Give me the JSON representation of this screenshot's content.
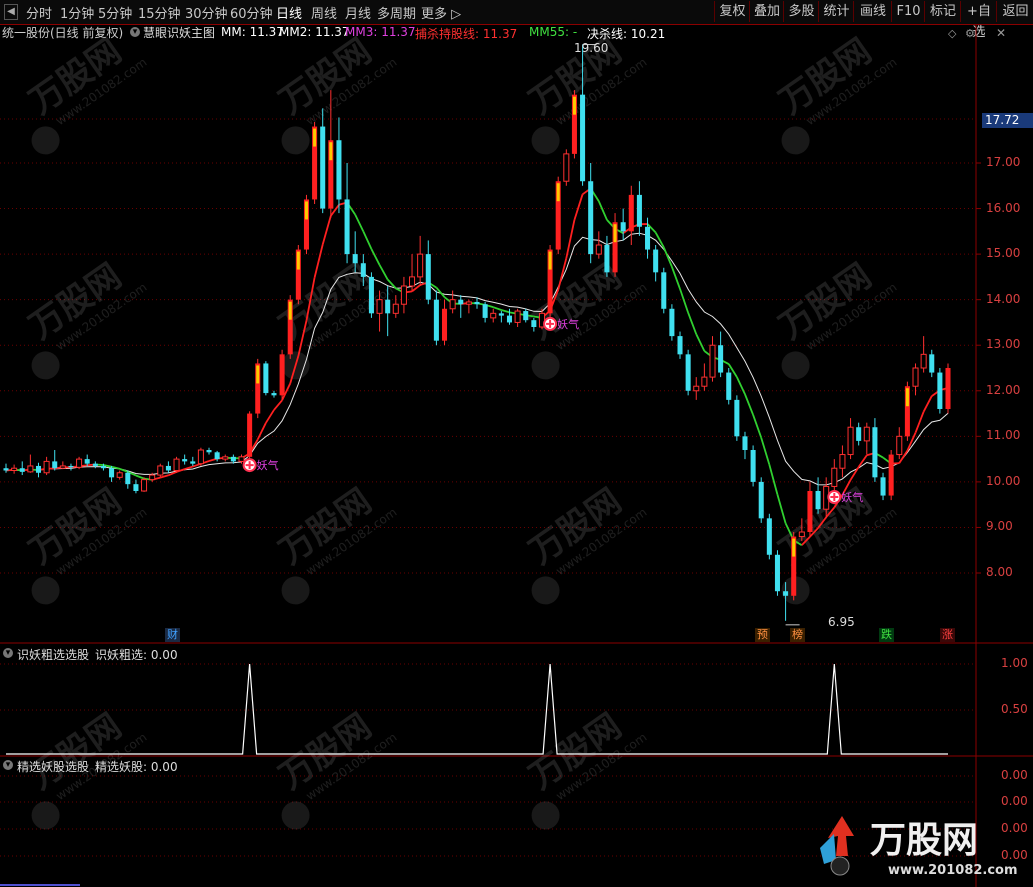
{
  "toolbar": {
    "tabs": [
      "分时",
      "1分钟",
      "5分钟",
      "15分钟",
      "30分钟",
      "60分钟",
      "日线",
      "周线",
      "月线",
      "多周期",
      "更多"
    ],
    "active_tab": "日线",
    "buttons": [
      "复权",
      "叠加",
      "多股",
      "统计",
      "画线",
      "F10",
      "标记",
      "+自选",
      "返回"
    ]
  },
  "main_panel": {
    "stock": "统一股份(日线 前复权)",
    "indicator_name": "慧眼识妖主图",
    "lines": [
      {
        "label": "MM: 11.37",
        "color": "#ffffff"
      },
      {
        "label": "MM2: 11.37",
        "color": "#ffffff"
      },
      {
        "label": "MM3: 11.37",
        "color": "#e040e0"
      },
      {
        "label": "捕杀持股线: 11.37",
        "color": "#ff3030"
      },
      {
        "label": "MM55: -",
        "color": "#40e040"
      },
      {
        "label": "决杀线: 10.21",
        "color": "#ffffff"
      }
    ],
    "price_tag": "17.72",
    "high_label": "19.60",
    "low_label": "6.95",
    "signal_text": "妖气",
    "y_labels": [
      "17.00",
      "16.00",
      "15.00",
      "14.00",
      "13.00",
      "12.00",
      "11.00",
      "10.00",
      "9.00",
      "8.00"
    ],
    "events": [
      {
        "text": "财",
        "color": "#40a0ff"
      },
      {
        "text": "预",
        "color": "#ff9040"
      },
      {
        "text": "榜",
        "color": "#ff9040"
      },
      {
        "text": "跌",
        "color": "#40e040"
      },
      {
        "text": "涨",
        "color": "#ff4040"
      }
    ]
  },
  "panel2": {
    "title": "识妖粗选选股",
    "value_label": "识妖粗选: 0.00",
    "y_labels": [
      "1.00",
      "0.50"
    ]
  },
  "panel3": {
    "title": "精选妖股选股",
    "value_label": "精选妖股: 0.00",
    "y_labels": [
      "0.00",
      "0.00",
      "0.00",
      "0.00"
    ]
  },
  "watermark": {
    "brand": "万股网",
    "url": "www.201082.com"
  },
  "chart_data": {
    "type": "candlestick",
    "ylim": [
      6.8,
      19.8
    ],
    "signals_day_index": [
      30,
      67,
      102
    ],
    "candles": [
      [
        10.3,
        10.25,
        10.4,
        10.2
      ],
      [
        10.25,
        10.3,
        10.38,
        10.18
      ],
      [
        10.3,
        10.22,
        10.45,
        10.15
      ],
      [
        10.22,
        10.35,
        10.6,
        10.2
      ],
      [
        10.35,
        10.2,
        10.42,
        10.1
      ],
      [
        10.2,
        10.45,
        10.55,
        10.15
      ],
      [
        10.45,
        10.3,
        10.7,
        10.25
      ],
      [
        10.3,
        10.35,
        10.45,
        10.28
      ],
      [
        10.35,
        10.32,
        10.4,
        10.25
      ],
      [
        10.32,
        10.5,
        10.55,
        10.28
      ],
      [
        10.5,
        10.4,
        10.6,
        10.35
      ],
      [
        10.4,
        10.35,
        10.45,
        10.3
      ],
      [
        10.35,
        10.3,
        10.4,
        10.25
      ],
      [
        10.3,
        10.1,
        10.35,
        10.0
      ],
      [
        10.1,
        10.2,
        10.25,
        10.05
      ],
      [
        10.2,
        9.95,
        10.25,
        9.85
      ],
      [
        9.95,
        9.8,
        10.05,
        9.75
      ],
      [
        9.8,
        10.05,
        10.1,
        9.78
      ],
      [
        10.05,
        10.15,
        10.2,
        10.0
      ],
      [
        10.15,
        10.35,
        10.4,
        10.1
      ],
      [
        10.35,
        10.25,
        10.45,
        10.2
      ],
      [
        10.25,
        10.5,
        10.55,
        10.2
      ],
      [
        10.5,
        10.45,
        10.6,
        10.38
      ],
      [
        10.45,
        10.4,
        10.55,
        10.35
      ],
      [
        10.4,
        10.7,
        10.75,
        10.35
      ],
      [
        10.7,
        10.65,
        10.75,
        10.6
      ],
      [
        10.65,
        10.5,
        10.68,
        10.45
      ],
      [
        10.5,
        10.55,
        10.6,
        10.45
      ],
      [
        10.55,
        10.45,
        10.6,
        10.4
      ],
      [
        10.45,
        10.55,
        10.6,
        10.4
      ],
      [
        10.55,
        11.5,
        11.55,
        10.5
      ],
      [
        11.5,
        12.6,
        12.7,
        11.4
      ],
      [
        12.6,
        11.95,
        12.65,
        11.9
      ],
      [
        11.95,
        11.9,
        12.0,
        11.85
      ],
      [
        11.9,
        12.8,
        12.9,
        11.8
      ],
      [
        12.8,
        14.0,
        14.1,
        12.7
      ],
      [
        14.0,
        15.1,
        15.2,
        13.9
      ],
      [
        15.1,
        16.2,
        16.3,
        15.0
      ],
      [
        16.2,
        17.8,
        17.9,
        16.1
      ],
      [
        17.8,
        16.0,
        18.2,
        15.9
      ],
      [
        16.0,
        17.5,
        18.6,
        15.8
      ],
      [
        17.5,
        16.2,
        18.0,
        15.9
      ],
      [
        16.2,
        15.0,
        17.0,
        14.8
      ],
      [
        15.0,
        14.8,
        15.5,
        14.6
      ],
      [
        14.8,
        14.5,
        15.0,
        14.3
      ],
      [
        14.5,
        13.7,
        14.6,
        13.6
      ],
      [
        13.7,
        14.0,
        14.2,
        13.3
      ],
      [
        14.0,
        13.7,
        14.3,
        13.2
      ],
      [
        13.7,
        13.9,
        14.1,
        13.6
      ],
      [
        13.9,
        14.3,
        14.5,
        13.7
      ],
      [
        14.3,
        14.5,
        15.0,
        14.2
      ],
      [
        14.5,
        15.0,
        15.4,
        14.3
      ],
      [
        15.0,
        14.0,
        15.3,
        13.9
      ],
      [
        14.0,
        13.1,
        14.2,
        13.0
      ],
      [
        13.1,
        13.8,
        14.0,
        13.0
      ],
      [
        13.8,
        14.0,
        14.2,
        13.7
      ],
      [
        14.0,
        13.9,
        14.1,
        13.6
      ],
      [
        13.9,
        13.95,
        14.0,
        13.7
      ],
      [
        13.95,
        13.9,
        14.05,
        13.8
      ],
      [
        13.9,
        13.6,
        13.95,
        13.5
      ],
      [
        13.6,
        13.7,
        13.8,
        13.5
      ],
      [
        13.7,
        13.65,
        13.75,
        13.5
      ],
      [
        13.65,
        13.5,
        13.8,
        13.45
      ],
      [
        13.5,
        13.75,
        13.8,
        13.4
      ],
      [
        13.75,
        13.55,
        13.8,
        13.5
      ],
      [
        13.55,
        13.4,
        13.6,
        13.3
      ],
      [
        13.4,
        13.7,
        13.8,
        13.35
      ],
      [
        13.7,
        15.1,
        15.2,
        13.6
      ],
      [
        15.1,
        16.6,
        16.7,
        15.0
      ],
      [
        16.6,
        17.2,
        17.3,
        16.5
      ],
      [
        17.2,
        18.5,
        18.6,
        17.1
      ],
      [
        18.5,
        16.6,
        19.6,
        16.5
      ],
      [
        16.6,
        15.0,
        17.0,
        14.8
      ],
      [
        15.0,
        15.2,
        15.5,
        14.9
      ],
      [
        15.2,
        14.6,
        15.4,
        14.5
      ],
      [
        14.6,
        15.7,
        15.9,
        14.5
      ],
      [
        15.7,
        15.5,
        16.0,
        15.3
      ],
      [
        15.5,
        16.3,
        16.5,
        15.2
      ],
      [
        16.3,
        15.6,
        16.6,
        15.4
      ],
      [
        15.6,
        15.1,
        15.8,
        14.9
      ],
      [
        15.1,
        14.6,
        15.2,
        14.4
      ],
      [
        14.6,
        13.8,
        14.7,
        13.7
      ],
      [
        13.8,
        13.2,
        13.9,
        13.1
      ],
      [
        13.2,
        12.8,
        13.3,
        12.7
      ],
      [
        12.8,
        12.0,
        12.9,
        11.9
      ],
      [
        12.0,
        12.1,
        12.3,
        11.8
      ],
      [
        12.1,
        12.3,
        12.6,
        12.0
      ],
      [
        12.3,
        13.0,
        13.2,
        12.2
      ],
      [
        13.0,
        12.4,
        13.3,
        12.3
      ],
      [
        12.4,
        11.8,
        12.5,
        11.7
      ],
      [
        11.8,
        11.0,
        11.9,
        10.9
      ],
      [
        11.0,
        10.7,
        11.1,
        10.5
      ],
      [
        10.7,
        10.0,
        10.8,
        9.9
      ],
      [
        10.0,
        9.2,
        10.1,
        9.1
      ],
      [
        9.2,
        8.4,
        9.3,
        8.3
      ],
      [
        8.4,
        7.6,
        8.5,
        7.5
      ],
      [
        7.6,
        7.5,
        7.8,
        6.95
      ],
      [
        7.5,
        8.8,
        8.9,
        7.4
      ],
      [
        8.8,
        8.9,
        9.2,
        8.7
      ],
      [
        8.9,
        9.8,
        10.0,
        8.8
      ],
      [
        9.8,
        9.4,
        10.1,
        9.3
      ],
      [
        9.4,
        9.9,
        10.1,
        9.2
      ],
      [
        9.9,
        10.3,
        10.5,
        9.8
      ],
      [
        10.3,
        10.6,
        10.8,
        10.1
      ],
      [
        10.6,
        11.2,
        11.4,
        10.5
      ],
      [
        11.2,
        10.9,
        11.3,
        10.8
      ],
      [
        10.9,
        11.2,
        11.3,
        10.6
      ],
      [
        11.2,
        10.1,
        11.4,
        10.0
      ],
      [
        10.1,
        9.7,
        10.2,
        9.6
      ],
      [
        9.7,
        10.6,
        10.7,
        9.6
      ],
      [
        10.6,
        11.0,
        11.2,
        10.5
      ],
      [
        11.0,
        12.1,
        12.2,
        10.9
      ],
      [
        12.1,
        12.5,
        12.6,
        11.9
      ],
      [
        12.5,
        12.8,
        13.2,
        12.4
      ],
      [
        12.8,
        12.4,
        12.9,
        12.3
      ],
      [
        12.4,
        11.6,
        12.5,
        11.5
      ],
      [
        11.6,
        12.5,
        12.6,
        11.5
      ]
    ]
  }
}
